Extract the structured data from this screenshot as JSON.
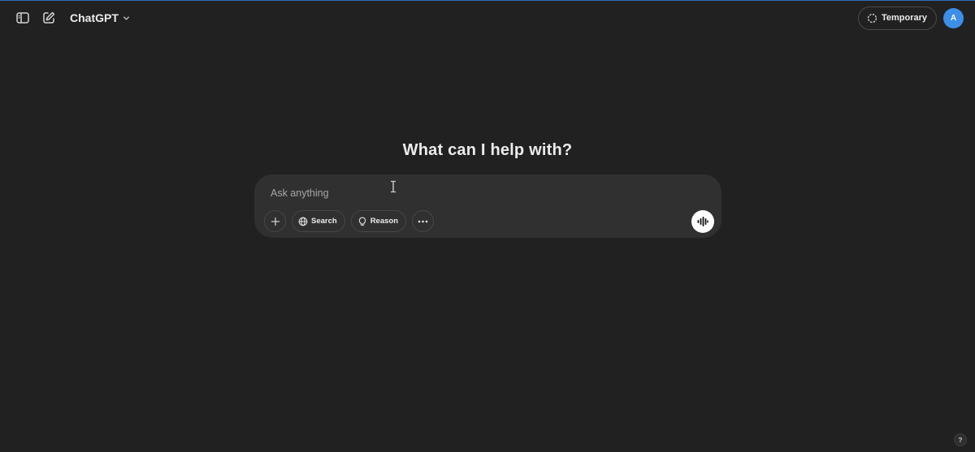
{
  "header": {
    "model_name": "ChatGPT",
    "temporary_label": "Temporary",
    "avatar_initial": "A",
    "icons": [
      "sidebar-toggle-icon",
      "new-chat-icon",
      "chevron-down-icon",
      "temporary-chat-icon"
    ]
  },
  "main": {
    "headline": "What can I help with?"
  },
  "composer": {
    "placeholder": "Ask anything",
    "value": "",
    "tools": {
      "search_label": "Search",
      "reason_label": "Reason"
    },
    "icons": [
      "plus-icon",
      "globe-icon",
      "lightbulb-icon",
      "more-icon",
      "voice-waveform-icon"
    ]
  },
  "help": {
    "label": "?"
  },
  "colors": {
    "background": "#212121",
    "composer": "#303030",
    "accent_avatar": "#3b8fe9",
    "top_border": "#2f6fb8"
  }
}
